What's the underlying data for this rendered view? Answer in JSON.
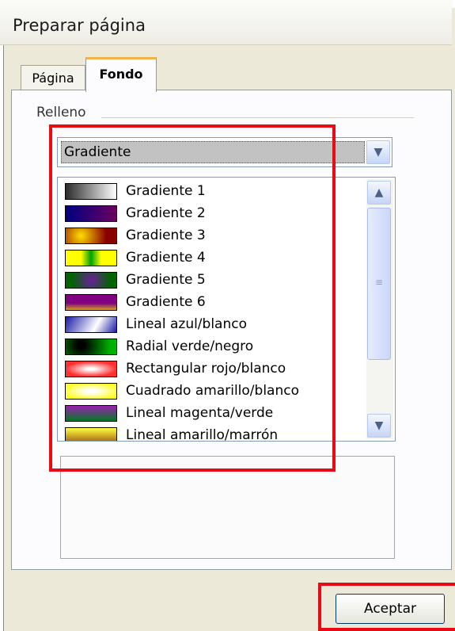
{
  "window": {
    "title": "Preparar página"
  },
  "tabs": [
    {
      "label": "Página",
      "active": false
    },
    {
      "label": "Fondo",
      "active": true
    }
  ],
  "fill_group": {
    "label": "Relleno"
  },
  "fill_type": {
    "selected": "Gradiente"
  },
  "gradient_list": {
    "items": [
      {
        "label": "Gradiente 1",
        "swatch": "linear-gradient(90deg,#2b2b2b,#ffffff)"
      },
      {
        "label": "Gradiente 2",
        "swatch": "linear-gradient(90deg,#000080,#6b0060)"
      },
      {
        "label": "Gradiente 3",
        "swatch": "radial-gradient(circle at 30% 50%,#ffde00,#8a0000 70%)"
      },
      {
        "label": "Gradiente 4",
        "swatch": "linear-gradient(90deg,#ffff00 30%,#00a000 50%,#ffff00 70%)"
      },
      {
        "label": "Gradiente 5",
        "swatch": "radial-gradient(circle at 50% 50%,#6a1f9a,#006400 75%)"
      },
      {
        "label": "Gradiente 6",
        "swatch": "linear-gradient(180deg,#800080 55%,#d4a020 100%)"
      },
      {
        "label": "Lineal azul/blanco",
        "swatch": "linear-gradient(120deg,#1a1aa8,#ffffff 60%,#1a1aa8)"
      },
      {
        "label": "Radial verde/negro",
        "swatch": "radial-gradient(circle at 30% 40%,#000000 10%,#00b000 80%)"
      },
      {
        "label": "Rectangular rojo/blanco",
        "swatch": "radial-gradient(ellipse at 50% 50%,#ffffff 10%,#ff3030 70%)"
      },
      {
        "label": "Cuadrado amarillo/blanco",
        "swatch": "radial-gradient(ellipse at 50% 50%,#ffffff 15%,#ffff30 75%)"
      },
      {
        "label": "Lineal magenta/verde",
        "swatch": "linear-gradient(180deg,#9a1fb0,#007a20)"
      },
      {
        "label": "Lineal amarillo/marrón",
        "swatch": "linear-gradient(180deg,#ffff40,#a05a10)"
      }
    ]
  },
  "buttons": {
    "ok": "Aceptar"
  },
  "icons": {
    "combo_arrow": "chevron-down-icon",
    "scroll_up": "chevron-up-icon",
    "scroll_down": "chevron-down-icon",
    "scroll_grip": "grip-icon"
  },
  "colors": {
    "highlight": "#e80b16",
    "tab_accent": "#f4b04b"
  }
}
